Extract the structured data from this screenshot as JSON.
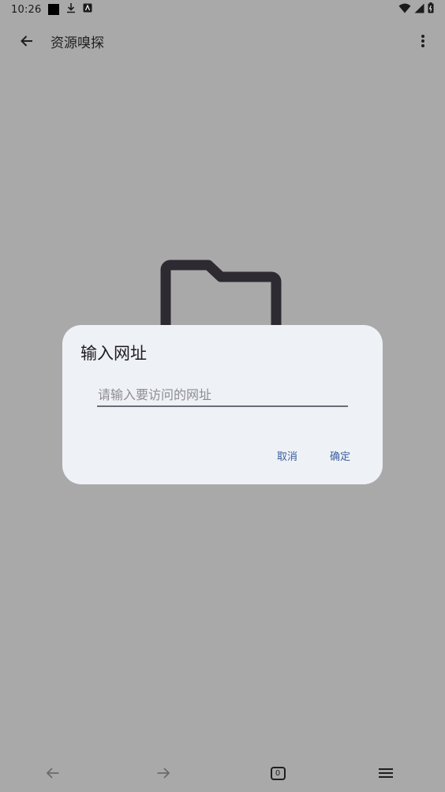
{
  "status_bar": {
    "time": "10:26",
    "icons": [
      "app-square-icon",
      "download-icon",
      "keyboard-icon",
      "wifi-icon",
      "signal-icon",
      "battery-icon"
    ]
  },
  "app_bar": {
    "title": "资源嗅探",
    "icons": [
      "back-arrow-icon",
      "more-vert-icon"
    ]
  },
  "dialog": {
    "title": "输入网址",
    "input": {
      "placeholder": "请输入要访问的网址",
      "value": ""
    },
    "cancel_label": "取消",
    "confirm_label": "确定",
    "accent_color": "#3a5f9e"
  },
  "bottom_nav": {
    "tab_count": "0",
    "icons": [
      "back-arrow-icon",
      "forward-arrow-icon",
      "tabs-icon",
      "menu-icon"
    ]
  },
  "colors": {
    "scrim": "#a9a9a9",
    "dialog_bg": "#eef1f6",
    "text": "#1d1b20"
  }
}
